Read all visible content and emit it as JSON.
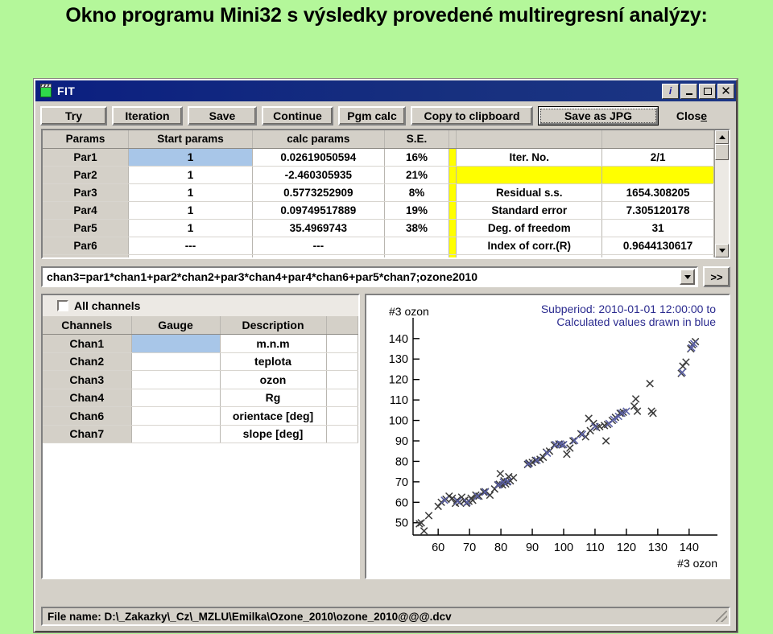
{
  "slide": {
    "heading": "Okno programu Mini32 s výsledky provedené multiregresní analýzy:"
  },
  "window": {
    "title": "FIT",
    "icon": "fit-app-icon",
    "controls": {
      "info": "i",
      "minimize": "_",
      "maximize": "□",
      "close": "✕"
    }
  },
  "toolbar": {
    "buttons": [
      {
        "label": "Try",
        "name": "try-button",
        "style": "normal"
      },
      {
        "label": "Iteration",
        "name": "iteration-button",
        "style": "normal"
      },
      {
        "label": "Save",
        "name": "save-button",
        "style": "normal"
      },
      {
        "label": "Continue",
        "name": "continue-button",
        "style": "normal"
      },
      {
        "label": "Pgm calc",
        "name": "pgm-calc-button",
        "style": "normal"
      },
      {
        "label": "Copy to clipboard",
        "name": "copy-to-clipboard-button",
        "style": "normal"
      },
      {
        "label": "Save as JPG",
        "name": "save-as-jpg-button",
        "style": "default"
      },
      {
        "label": "Close",
        "name": "close-button",
        "style": "flat",
        "accel": "e"
      }
    ]
  },
  "params_grid": {
    "headers": [
      "Params",
      "Start params",
      "calc params",
      "S.E.",
      "",
      ""
    ],
    "rows": [
      {
        "param": "Par1",
        "start": "1",
        "calc": "0.02619050594",
        "se": "16%",
        "stat_label": "Iter. No.",
        "stat_value": "2/1",
        "start_selected": true,
        "highlight": false
      },
      {
        "param": "Par2",
        "start": "1",
        "calc": "-2.460305935",
        "se": "21%",
        "stat_label": "",
        "stat_value": "",
        "start_selected": false,
        "highlight": true
      },
      {
        "param": "Par3",
        "start": "1",
        "calc": "0.5773252909",
        "se": "8%",
        "stat_label": "Residual s.s.",
        "stat_value": "1654.308205",
        "start_selected": false,
        "highlight": false
      },
      {
        "param": "Par4",
        "start": "1",
        "calc": "0.09749517889",
        "se": "19%",
        "stat_label": "Standard error",
        "stat_value": "7.305120178",
        "start_selected": false,
        "highlight": false
      },
      {
        "param": "Par5",
        "start": "1",
        "calc": "35.4969743",
        "se": "38%",
        "stat_label": "Deg. of freedom",
        "stat_value": "31",
        "start_selected": false,
        "highlight": false
      },
      {
        "param": "Par6",
        "start": "---",
        "calc": "---",
        "se": "",
        "stat_label": "Index of corr.(R)",
        "stat_value": "0.9644130617",
        "start_selected": false,
        "highlight": false
      }
    ]
  },
  "formula": {
    "value": "chan3=par1*chan1+par2*chan2+par3*chan4+par4*chan6+par5*chan7;ozone2010",
    "expand_label": ">>"
  },
  "channels": {
    "all_channels_label": "All channels",
    "all_channels_checked": false,
    "headers": [
      "Channels",
      "Gauge",
      "Description"
    ],
    "rows": [
      {
        "channel": "Chan1",
        "gauge": "",
        "description": "m.n.m",
        "gauge_selected": true
      },
      {
        "channel": "Chan2",
        "gauge": "",
        "description": "teplota",
        "gauge_selected": false
      },
      {
        "channel": "Chan3",
        "gauge": "",
        "description": "ozon",
        "gauge_selected": false
      },
      {
        "channel": "Chan4",
        "gauge": "",
        "description": "Rg",
        "gauge_selected": false
      },
      {
        "channel": "Chan6",
        "gauge": "",
        "description": "orientace [deg]",
        "gauge_selected": false
      },
      {
        "channel": "Chan7",
        "gauge": "",
        "description": "slope [deg]",
        "gauge_selected": false
      }
    ]
  },
  "statusbar": {
    "text": "File name: D:\\_Zakazky\\_Cz\\_MZLU\\Emilka\\Ozone_2010\\ozone_2010@@@.dcv"
  },
  "chart_data": {
    "type": "scatter",
    "title": "#3 ozon",
    "annotations": [
      "Subperiod: 2010-01-01 12:00:00 to",
      "Calculated values drawn in blue"
    ],
    "annotation_color": "#2b2b8f",
    "xlabel": "#3 ozon",
    "ylabel": "#3 ozon",
    "xlim": [
      52,
      148
    ],
    "ylim": [
      44,
      147
    ],
    "xticks": [
      60,
      70,
      80,
      90,
      100,
      110,
      120,
      130,
      140
    ],
    "yticks": [
      50,
      60,
      70,
      80,
      90,
      100,
      110,
      120,
      130,
      140
    ],
    "grid": false,
    "legend": "none",
    "marker": "x",
    "series": [
      {
        "name": "measured",
        "color": "#3a3a3a",
        "points": [
          [
            55.5,
            46.0
          ],
          [
            54.0,
            49.5
          ],
          [
            54.6,
            50.0
          ],
          [
            57.0,
            53.5
          ],
          [
            60.0,
            58.0
          ],
          [
            61.0,
            60.0
          ],
          [
            62.5,
            61.5
          ],
          [
            63.5,
            63.0
          ],
          [
            64.5,
            62.0
          ],
          [
            65.5,
            59.5
          ],
          [
            66.0,
            61.0
          ],
          [
            66.8,
            60.0
          ],
          [
            67.5,
            62.5
          ],
          [
            68.5,
            61.0
          ],
          [
            69.0,
            59.5
          ],
          [
            69.8,
            60.5
          ],
          [
            70.5,
            62.0
          ],
          [
            71.0,
            61.0
          ],
          [
            72.0,
            63.5
          ],
          [
            73.0,
            63.0
          ],
          [
            74.5,
            65.0
          ],
          [
            75.0,
            65.2
          ],
          [
            76.5,
            63.5
          ],
          [
            78.0,
            66.5
          ],
          [
            79.0,
            68.5
          ],
          [
            79.5,
            68.8
          ],
          [
            80.5,
            68.5
          ],
          [
            81.0,
            70.5
          ],
          [
            81.5,
            69.0
          ],
          [
            82.0,
            70.0
          ],
          [
            83.0,
            70.5
          ],
          [
            79.8,
            74.0
          ],
          [
            82.5,
            72.5
          ],
          [
            84.0,
            72.0
          ],
          [
            88.5,
            78.5
          ],
          [
            89.0,
            79.2
          ],
          [
            90.0,
            79.5
          ],
          [
            91.0,
            80.5
          ],
          [
            92.5,
            81.0
          ],
          [
            93.5,
            82.0
          ],
          [
            94.5,
            84.5
          ],
          [
            95.5,
            85.0
          ],
          [
            97.0,
            88.0
          ],
          [
            98.5,
            88.5
          ],
          [
            99.5,
            88.0
          ],
          [
            101.0,
            83.5
          ],
          [
            102.0,
            86.5
          ],
          [
            103.0,
            90.0
          ],
          [
            105.5,
            93.5
          ],
          [
            107.0,
            92.0
          ],
          [
            108.5,
            95.0
          ],
          [
            109.5,
            98.5
          ],
          [
            110.5,
            96.5
          ],
          [
            111.5,
            97.0
          ],
          [
            113.0,
            97.5
          ],
          [
            114.0,
            98.0
          ],
          [
            115.5,
            100.0
          ],
          [
            116.5,
            101.5
          ],
          [
            118.0,
            103.5
          ],
          [
            119.0,
            104.0
          ],
          [
            113.5,
            90.0
          ],
          [
            108.0,
            101.0
          ],
          [
            122.5,
            107.0
          ],
          [
            123.0,
            110.5
          ],
          [
            123.5,
            104.5
          ],
          [
            127.5,
            118.0
          ],
          [
            128.0,
            104.5
          ],
          [
            128.5,
            103.5
          ],
          [
            137.5,
            123.0
          ],
          [
            138.0,
            126.5
          ],
          [
            139.0,
            128.5
          ],
          [
            140.5,
            135.0
          ],
          [
            141.0,
            137.0
          ],
          [
            142.0,
            138.5
          ]
        ]
      },
      {
        "name": "calculated",
        "color": "#5a5fa5",
        "points": [
          [
            62.0,
            61.0
          ],
          [
            66.2,
            60.5
          ],
          [
            69.2,
            60.0
          ],
          [
            72.5,
            63.0
          ],
          [
            75.0,
            65.0
          ],
          [
            79.2,
            68.5
          ],
          [
            80.8,
            69.8
          ],
          [
            82.2,
            70.2
          ],
          [
            88.8,
            78.8
          ],
          [
            91.5,
            80.5
          ],
          [
            94.8,
            84.0
          ],
          [
            97.5,
            88.2
          ],
          [
            99.0,
            88.5
          ],
          [
            100.0,
            88.2
          ],
          [
            103.5,
            90.2
          ],
          [
            106.0,
            93.2
          ],
          [
            110.0,
            97.0
          ],
          [
            114.5,
            98.5
          ],
          [
            116.0,
            100.5
          ],
          [
            117.5,
            102.0
          ],
          [
            118.5,
            103.5
          ],
          [
            120.0,
            104.5
          ],
          [
            137.8,
            123.5
          ],
          [
            140.8,
            135.5
          ],
          [
            141.5,
            137.5
          ]
        ]
      }
    ]
  }
}
